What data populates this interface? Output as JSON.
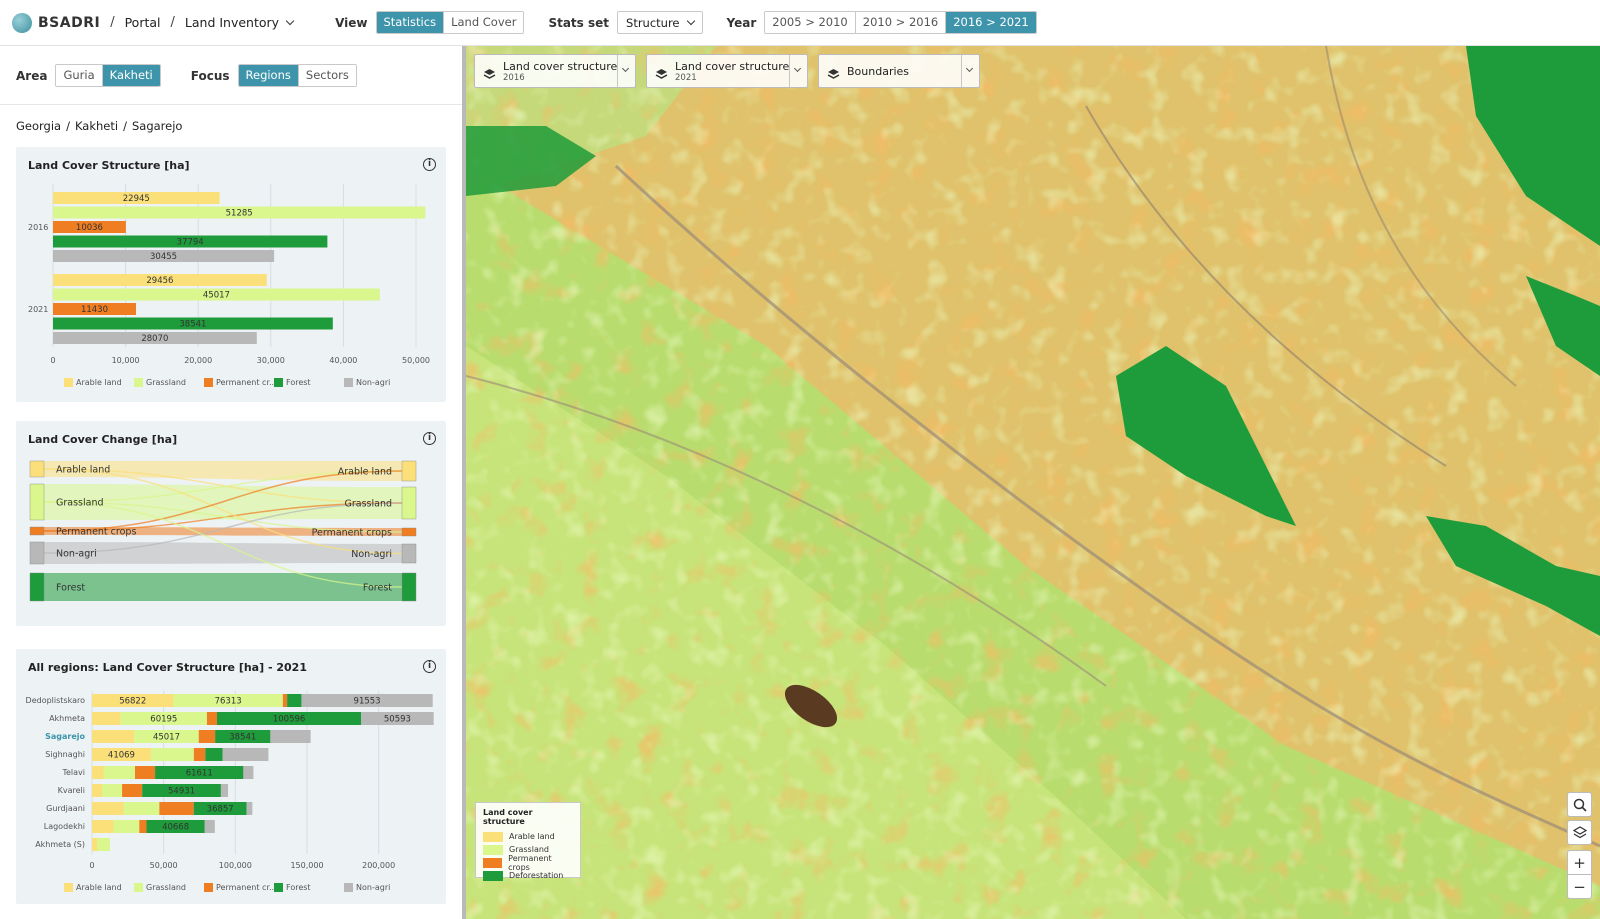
{
  "app": {
    "name": "BSADRI",
    "portal": "Portal",
    "section": "Land Inventory"
  },
  "toolbar": {
    "view_label": "View",
    "view_options": [
      "Statistics",
      "Land Cover"
    ],
    "view_selected": "Statistics",
    "stats_label": "Stats set",
    "stats_value": "Structure",
    "year_label": "Year",
    "year_options": [
      "2005 > 2010",
      "2010 > 2016",
      "2016 > 2021"
    ],
    "year_selected": "2016 > 2021"
  },
  "filters": {
    "area_label": "Area",
    "area_options": [
      "Guria",
      "Kakheti"
    ],
    "area_selected": "Kakheti",
    "focus_label": "Focus",
    "focus_options": [
      "Regions",
      "Sectors"
    ],
    "focus_selected": "Regions"
  },
  "breadcrumb": [
    "Georgia",
    "Kakheti",
    "Sagarejo"
  ],
  "colors": {
    "arable": "#fbe07a",
    "grassland": "#d9f78c",
    "permanent": "#ef7d22",
    "forest": "#1e9b3a",
    "nonagri": "#b8b8b8",
    "accent": "#3d94ab"
  },
  "legend_labels": [
    "Arable land",
    "Grassland",
    "Permanent cr...",
    "Forest",
    "Non-agri"
  ],
  "chart_data": [
    {
      "type": "bar",
      "orientation": "horizontal",
      "title": "Land Cover Structure [ha]",
      "categories": [
        "2016",
        "2021"
      ],
      "series": [
        {
          "name": "Arable land",
          "values": [
            22945,
            29456
          ]
        },
        {
          "name": "Grassland",
          "values": [
            51285,
            45017
          ]
        },
        {
          "name": "Permanent cr...",
          "values": [
            10036,
            11430
          ]
        },
        {
          "name": "Forest",
          "values": [
            37794,
            38541
          ]
        },
        {
          "name": "Non-agri",
          "values": [
            30455,
            28070
          ]
        }
      ],
      "xlim": [
        0,
        50000
      ],
      "xticks": [
        "0",
        "10,000",
        "20,000",
        "30,000",
        "40,000",
        "50,000"
      ],
      "legend": "bottom",
      "grid": true
    },
    {
      "type": "sankey",
      "title": "Land Cover Change [ha]",
      "nodes": [
        "Arable land",
        "Grassland",
        "Permanent crops",
        "Non-agri",
        "Forest"
      ]
    },
    {
      "type": "bar",
      "orientation": "horizontal",
      "stacked": true,
      "title": "All regions: Land Cover Structure [ha] - 2021",
      "categories": [
        "Dedoplistskaro",
        "Akhmeta",
        "Sagarejo",
        "Sighnaghi",
        "Telavi",
        "Kvareli",
        "Gurdjaani",
        "Lagodekhi",
        "Akhmeta (S)"
      ],
      "highlight": "Sagarejo",
      "series": [
        {
          "name": "Arable land",
          "values": [
            56822,
            20000,
            29456,
            41069,
            8000,
            7000,
            22000,
            15000,
            3500
          ]
        },
        {
          "name": "Grassland",
          "values": [
            76313,
            60195,
            45017,
            30000,
            22000,
            14000,
            25000,
            18000,
            9000
          ]
        },
        {
          "name": "Permanent cr...",
          "values": [
            3000,
            7000,
            11430,
            8000,
            14000,
            14000,
            24000,
            5000,
            0
          ]
        },
        {
          "name": "Forest",
          "values": [
            10000,
            100596,
            38541,
            12000,
            61611,
            54931,
            36857,
            40668,
            0
          ]
        },
        {
          "name": "Non-agri",
          "values": [
            91553,
            50593,
            28070,
            32000,
            7000,
            5000,
            4000,
            7000,
            0
          ]
        }
      ],
      "data_labels": [
        [
          "56822",
          "76313",
          "",
          "",
          "91553"
        ],
        [
          "",
          "60195",
          "",
          "100596",
          "50593"
        ],
        [
          "",
          "45017",
          "",
          "38541",
          ""
        ],
        [
          "41069",
          "",
          "",
          "",
          ""
        ],
        [
          "",
          "",
          "",
          "61611",
          ""
        ],
        [
          "",
          "",
          "",
          "54931",
          ""
        ],
        [
          "",
          "",
          "",
          "36857",
          ""
        ],
        [
          "",
          "",
          "",
          "40668",
          ""
        ],
        [
          "",
          "",
          "",
          "",
          ""
        ]
      ],
      "xlim": [
        0,
        240000
      ],
      "xticks": [
        "0",
        "50,000",
        "100,000",
        "150,000",
        "200,000"
      ],
      "legend": "bottom"
    }
  ],
  "map": {
    "layers": [
      {
        "title": "Land cover structure",
        "sub": "2016"
      },
      {
        "title": "Land cover structure",
        "sub": "2021"
      },
      {
        "title": "Boundaries",
        "sub": ""
      }
    ],
    "legend_title": "Land cover structure",
    "legend_items": [
      "Arable land",
      "Grassland",
      "Permanent crops",
      "Deforestation"
    ],
    "legend_colors": [
      "#fbe07a",
      "#d9f78c",
      "#ef7d22",
      "#1e9b3a"
    ],
    "zoom_in": "+",
    "zoom_out": "−"
  }
}
